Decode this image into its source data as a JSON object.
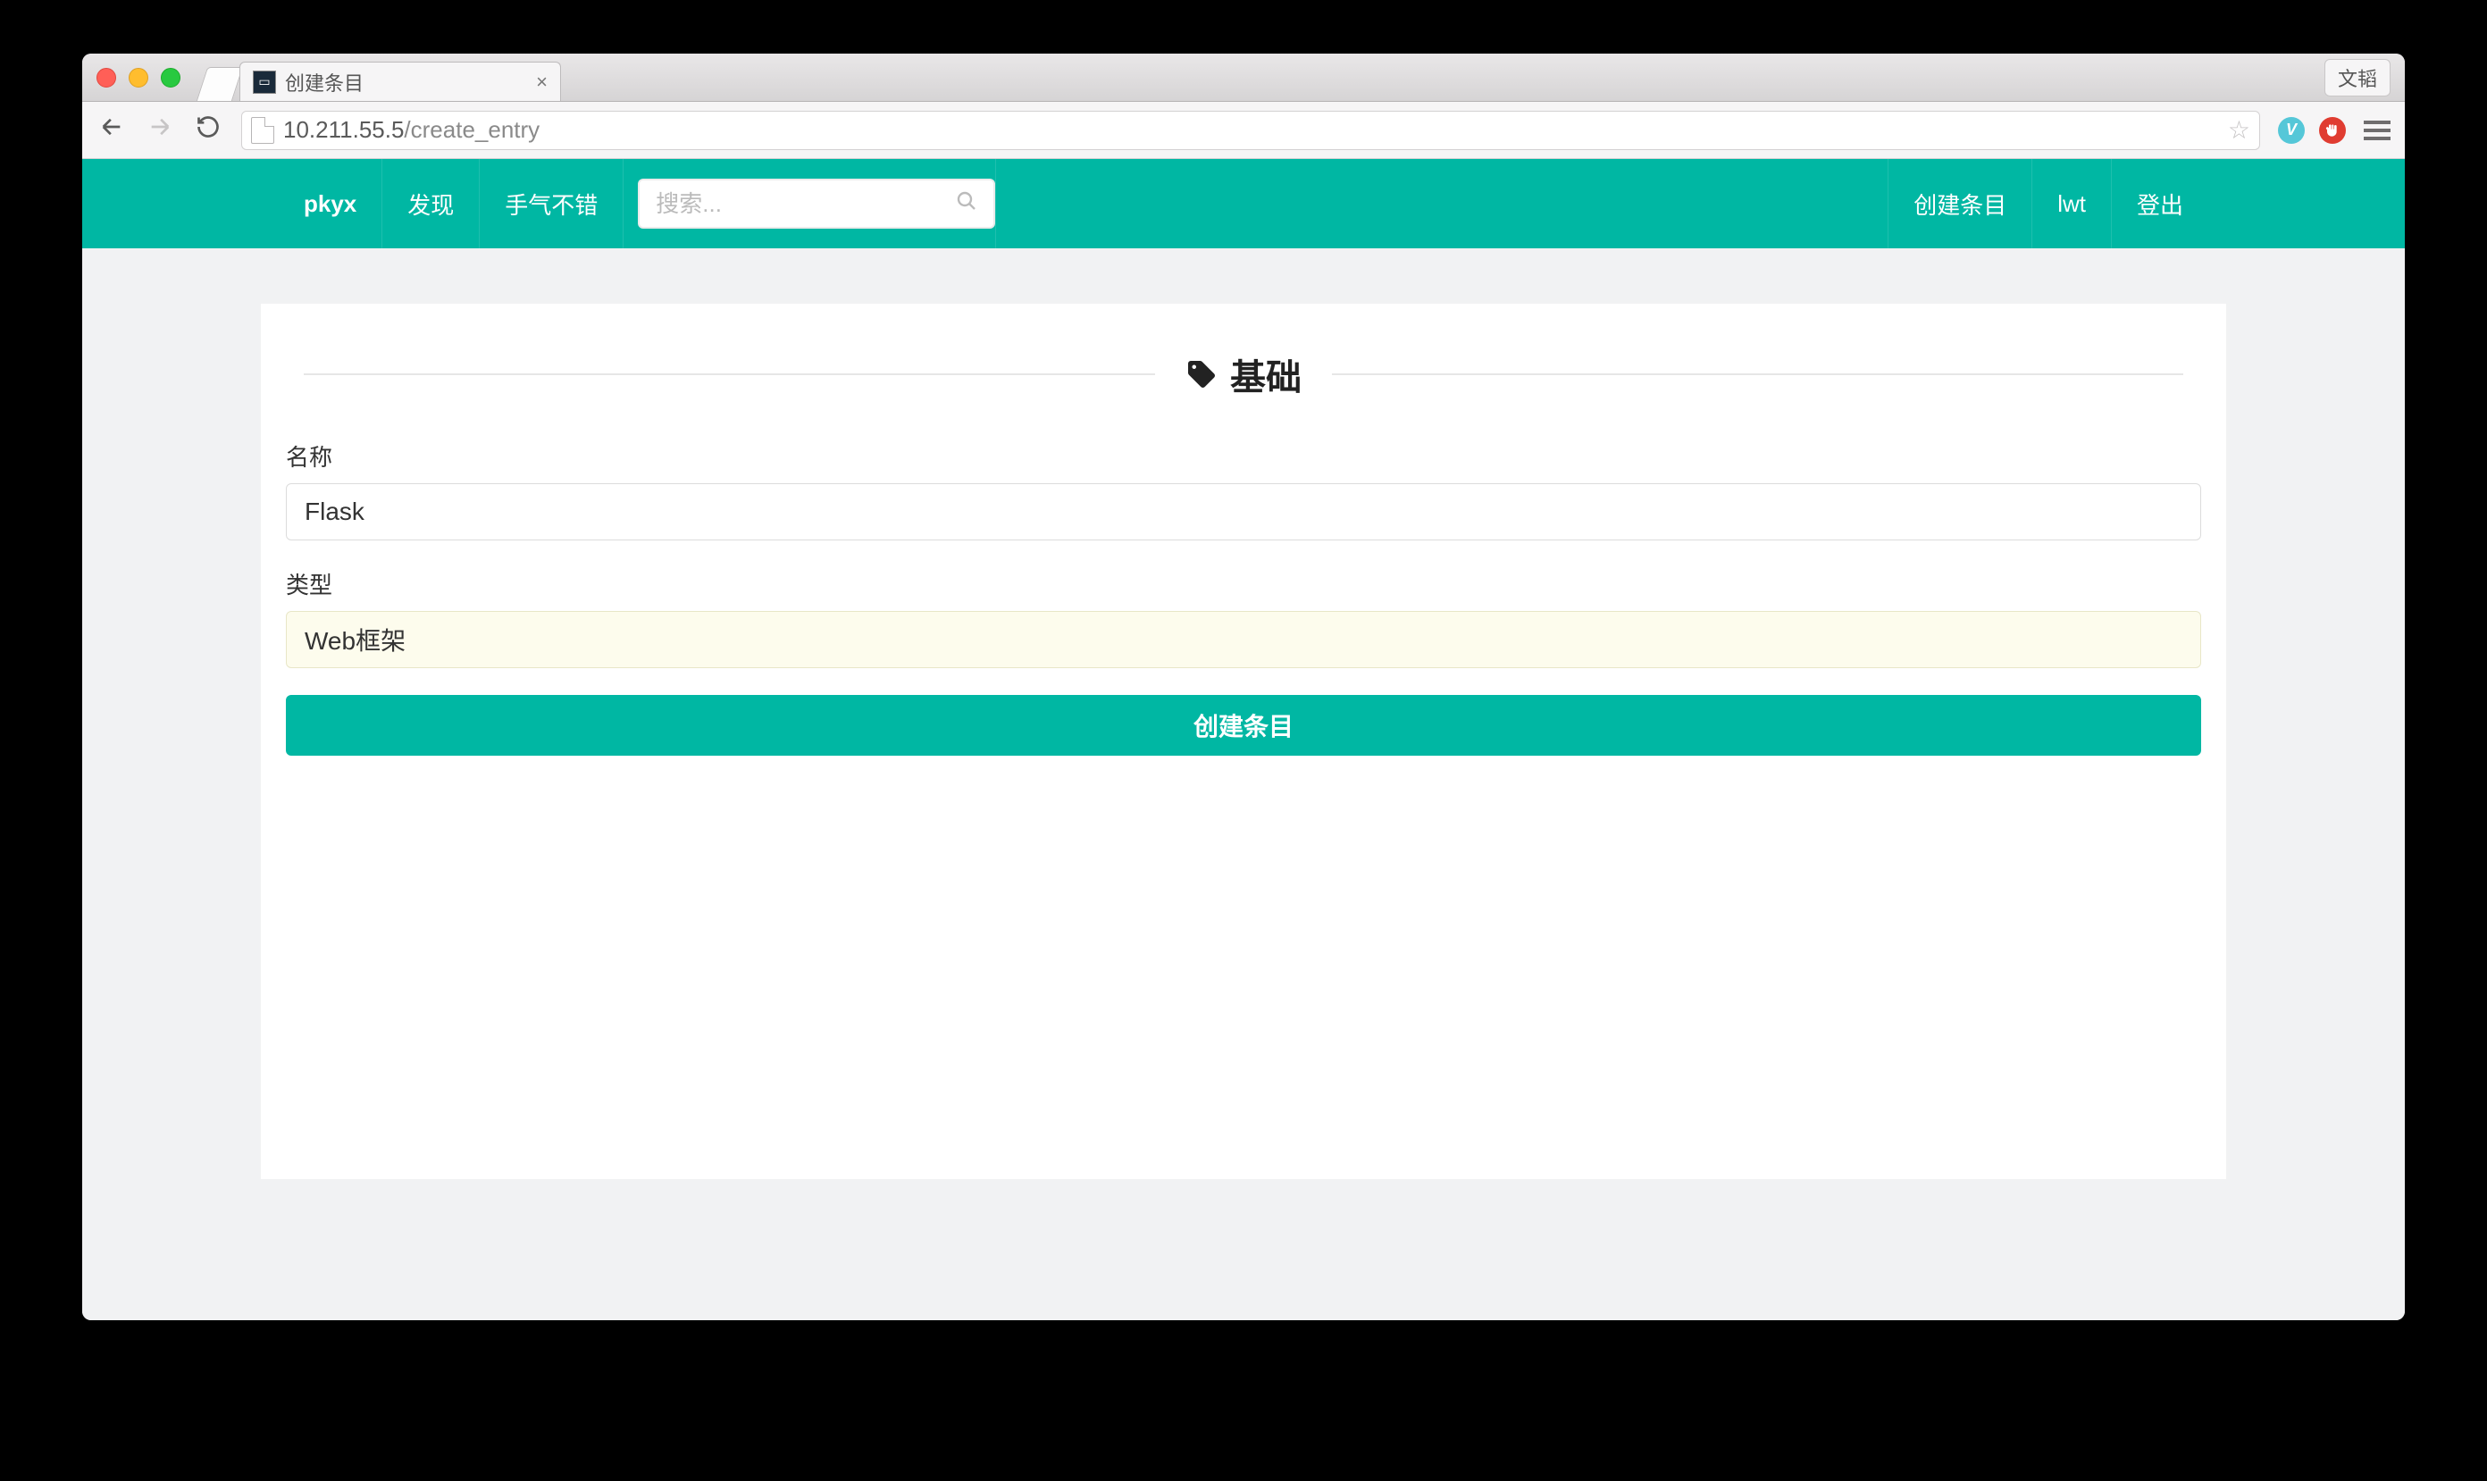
{
  "browser": {
    "tab_title": "创建条目",
    "user_chip": "文韬",
    "url_host": "10.211.55.5",
    "url_path": "/create_entry"
  },
  "nav": {
    "brand": "pkyx",
    "links": {
      "discover": "发现",
      "lucky": "手气不错"
    },
    "search_placeholder": "搜索...",
    "right": {
      "create_entry": "创建条目",
      "username": "lwt",
      "logout": "登出"
    }
  },
  "form": {
    "section_title": "基础",
    "name_label": "名称",
    "name_value": "Flask",
    "type_label": "类型",
    "type_value": "Web框架",
    "submit_label": "创建条目"
  }
}
